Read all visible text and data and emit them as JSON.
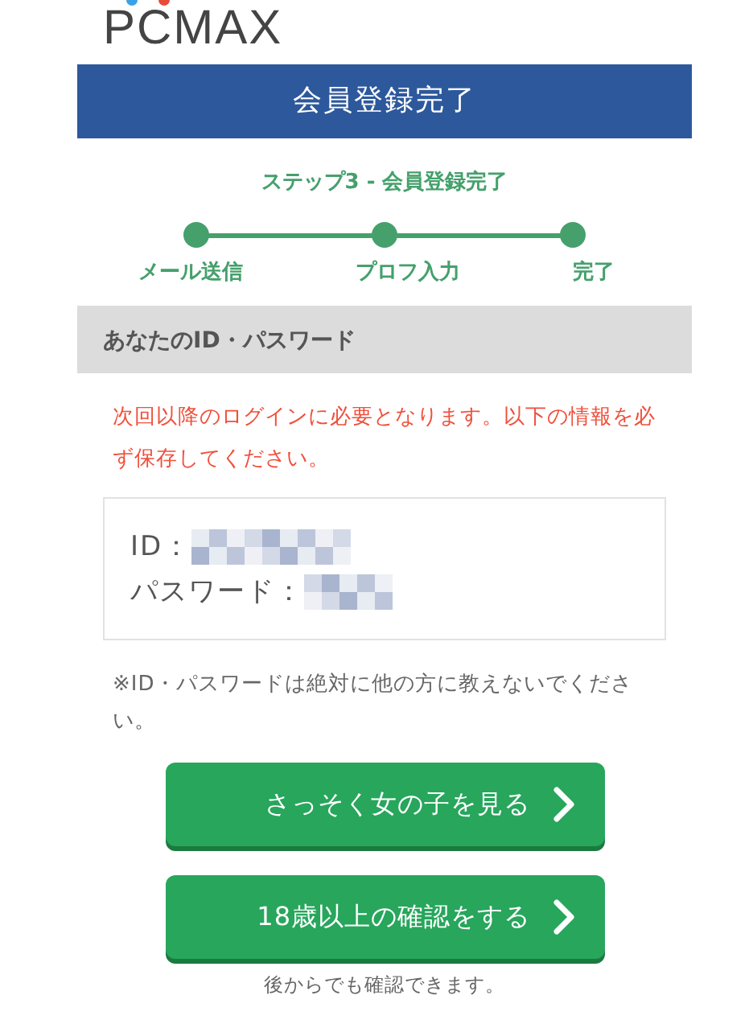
{
  "logo": {
    "text": "PCMAX"
  },
  "header": {
    "title": "会員登録完了"
  },
  "stepper": {
    "title": "ステップ3 - 会員登録完了",
    "steps": [
      {
        "label": "メール送信",
        "done": true
      },
      {
        "label": "プロフ入力",
        "done": true
      },
      {
        "label": "完了",
        "done": true
      }
    ]
  },
  "section": {
    "title": "あなたのID・パスワード"
  },
  "warning": "次回以降のログインに必要となります。以下の情報を必ず保存してください。",
  "credentials": [
    {
      "label": "ID："
    },
    {
      "label": "パスワード："
    }
  ],
  "note": "※ID・パスワードは絶対に他の方に教えないでください。",
  "buttons": [
    {
      "label": "さっそく女の子を見る"
    },
    {
      "label": "18歳以上の確認をする"
    }
  ],
  "footnote": "後からでも確認できます。"
}
